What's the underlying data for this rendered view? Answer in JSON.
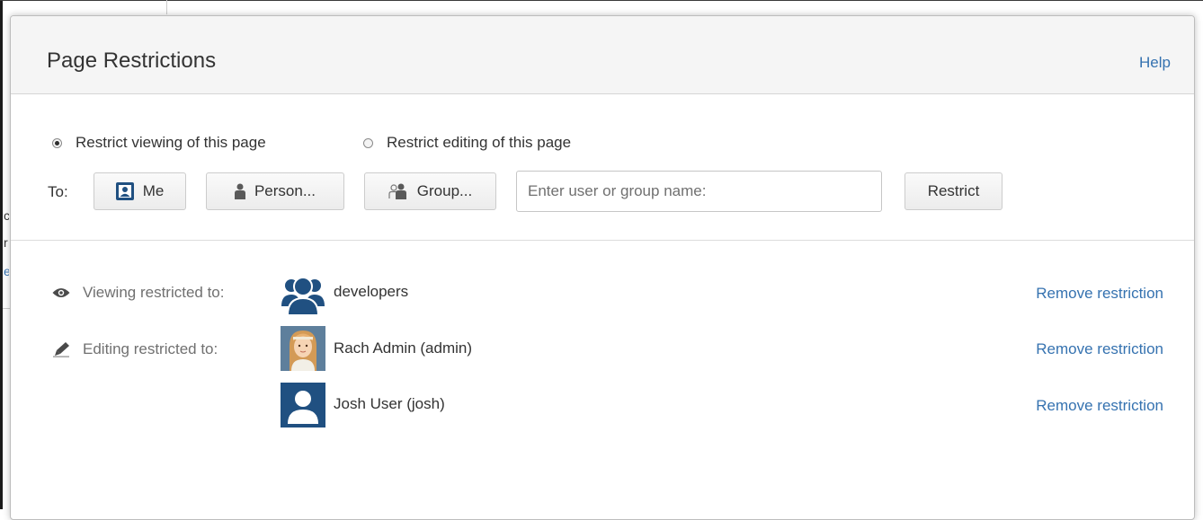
{
  "dialog": {
    "title": "Page Restrictions",
    "help_label": "Help"
  },
  "restriction_type": {
    "options": [
      {
        "label": "Restrict viewing of this page",
        "checked": true
      },
      {
        "label": "Restrict editing of this page",
        "checked": false
      }
    ]
  },
  "to": {
    "label": "To:",
    "me_button": "Me",
    "person_button": "Person...",
    "group_button": "Group...",
    "input_placeholder": "Enter user or group name:",
    "restrict_button": "Restrict"
  },
  "restrictions": {
    "viewing_label": "Viewing restricted to:",
    "editing_label": "Editing restricted to:",
    "entries": [
      {
        "name": "developers",
        "avatar": "group-avatar-icon",
        "remove_label": "Remove restriction"
      },
      {
        "name": "Rach Admin (admin)",
        "avatar": "user-photo-avatar",
        "remove_label": "Remove restriction"
      },
      {
        "name": "Josh User (josh)",
        "avatar": "default-user-avatar-icon",
        "remove_label": "Remove restriction"
      }
    ]
  },
  "background_fragments": [
    "c",
    "r",
    "e"
  ],
  "colors": {
    "link": "#3572b0",
    "avatar_blue": "#205081",
    "header_bg": "#f5f5f5",
    "muted_text": "#707070"
  }
}
